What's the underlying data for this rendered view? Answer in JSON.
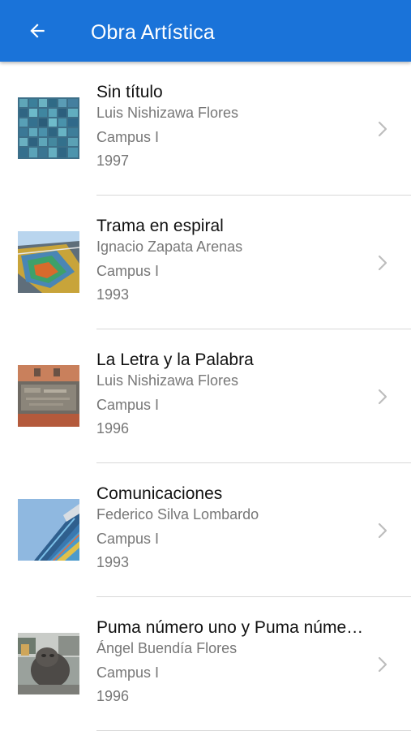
{
  "theme": {
    "accent": "#1a73d9"
  },
  "header": {
    "title": "Obra Artística",
    "back_icon": "arrow-left-icon"
  },
  "items": [
    {
      "title": "Sin título",
      "author": "Luis Nishizawa Flores",
      "campus": "Campus I",
      "year": "1997",
      "thumb_icon": "artwork-thumbnail-icon"
    },
    {
      "title": "Trama en espiral",
      "author": "Ignacio Zapata Arenas",
      "campus": "Campus I",
      "year": "1993",
      "thumb_icon": "artwork-thumbnail-icon"
    },
    {
      "title": "La Letra y la Palabra",
      "author": "Luis Nishizawa Flores",
      "campus": "Campus I",
      "year": "1996",
      "thumb_icon": "artwork-thumbnail-icon"
    },
    {
      "title": "Comunicaciones",
      "author": "Federico Silva Lombardo",
      "campus": "Campus I",
      "year": "1993",
      "thumb_icon": "artwork-thumbnail-icon"
    },
    {
      "title": "Puma número uno y Puma núme…",
      "author": "Ángel Buendía Flores",
      "campus": "Campus I",
      "year": "1996",
      "thumb_icon": "artwork-thumbnail-icon"
    }
  ]
}
